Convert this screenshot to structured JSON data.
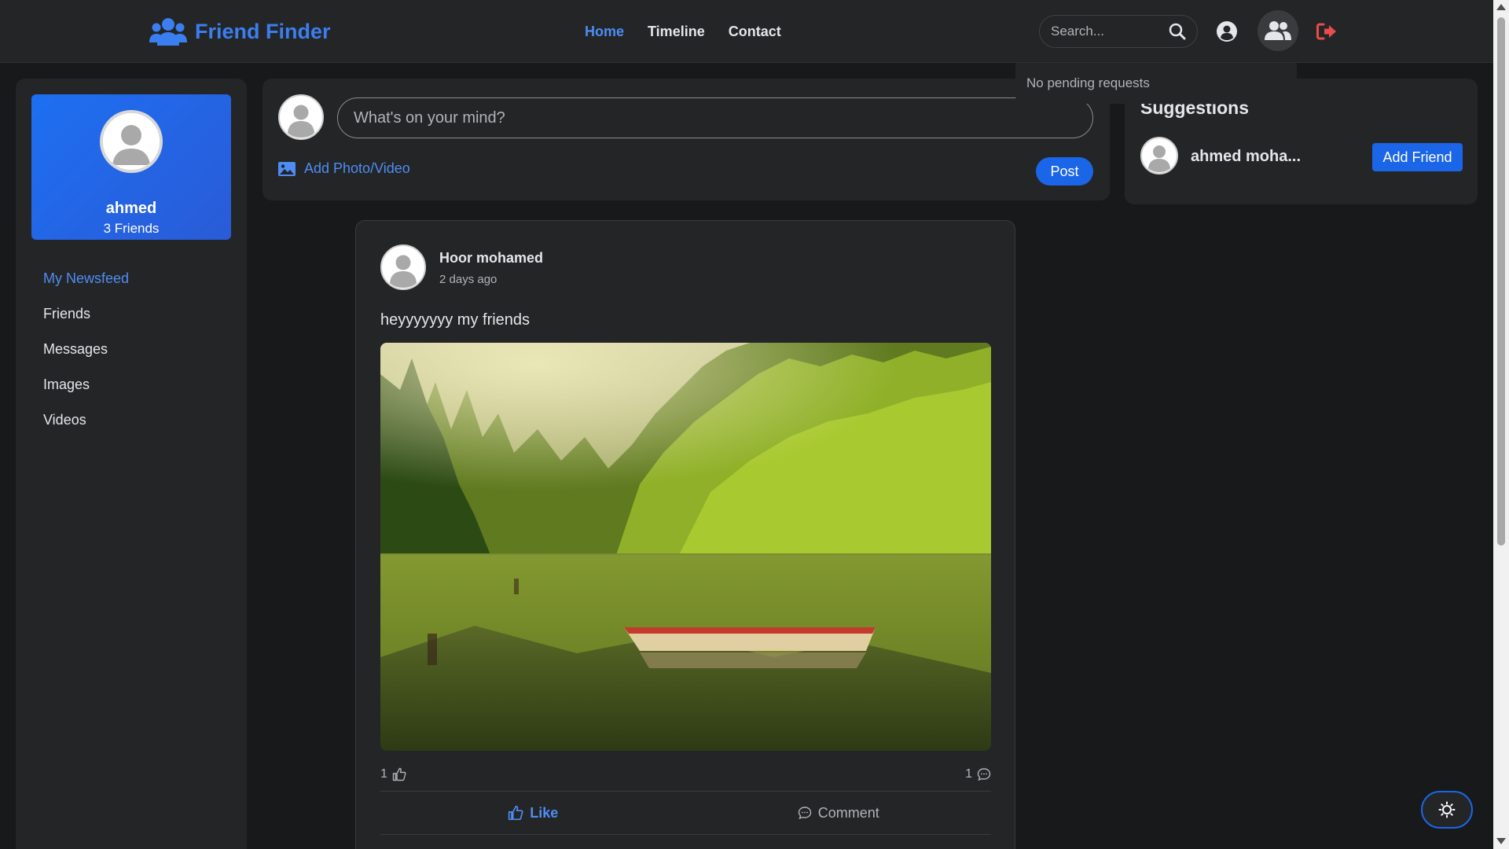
{
  "brand": {
    "name": "Friend Finder",
    "icon": "users-icon",
    "color": "#3b7ef0"
  },
  "nav": {
    "items": [
      {
        "label": "Home",
        "active": true
      },
      {
        "label": "Timeline",
        "active": false
      },
      {
        "label": "Contact",
        "active": false
      }
    ]
  },
  "search": {
    "placeholder": "Search...",
    "icon": "search-icon"
  },
  "topbar_icons": {
    "user": "user-circle-icon",
    "friends": "friends-icon",
    "logout": "logout-icon"
  },
  "requests_dropdown": {
    "text": "No pending requests"
  },
  "profile": {
    "name": "ahmed",
    "friends_count": "3 Friends"
  },
  "sidebar_menu": [
    {
      "label": "My Newsfeed",
      "active": true
    },
    {
      "label": "Friends",
      "active": false
    },
    {
      "label": "Messages",
      "active": false
    },
    {
      "label": "Images",
      "active": false
    },
    {
      "label": "Videos",
      "active": false
    }
  ],
  "composer": {
    "placeholder": "What's on your mind?",
    "add_media_label": "Add Photo/Video",
    "post_label": "Post"
  },
  "suggestions": {
    "title": "Suggestions",
    "items": [
      {
        "name": "ahmed moha...",
        "button_label": "Add Friend"
      }
    ]
  },
  "post": {
    "author": "Hoor mohamed",
    "time": "2 days ago",
    "text": "heyyyyyyy my friends",
    "image": "forest-lake-boat-photo",
    "likes_count": "1",
    "comments_count": "1",
    "like_label": "Like",
    "comment_label": "Comment"
  },
  "theme_toggle": {
    "icon": "sun-icon"
  },
  "colors": {
    "accent": "#1b66e8",
    "link": "#4e8df5",
    "background": "#18191a",
    "surface": "#242526",
    "logout": "#e84c4c"
  }
}
